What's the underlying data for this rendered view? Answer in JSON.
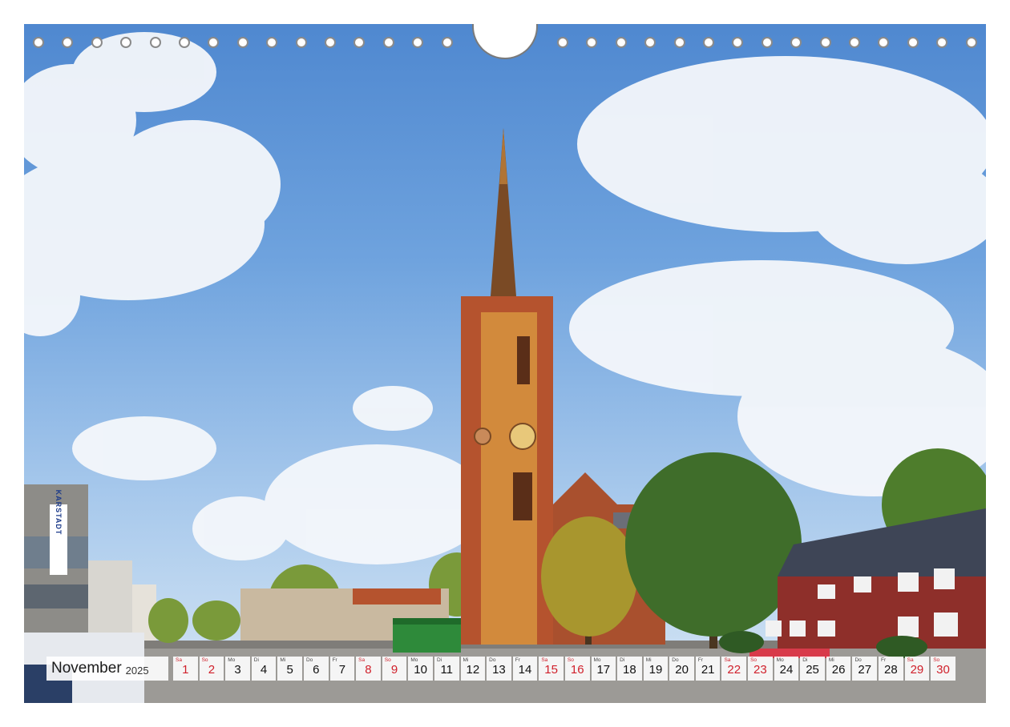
{
  "calendar": {
    "month": "November",
    "year": "2025",
    "days": [
      {
        "wd": "Sa",
        "num": "1",
        "weekend": true
      },
      {
        "wd": "So",
        "num": "2",
        "weekend": true
      },
      {
        "wd": "Mo",
        "num": "3",
        "weekend": false
      },
      {
        "wd": "Di",
        "num": "4",
        "weekend": false
      },
      {
        "wd": "Mi",
        "num": "5",
        "weekend": false
      },
      {
        "wd": "Do",
        "num": "6",
        "weekend": false
      },
      {
        "wd": "Fr",
        "num": "7",
        "weekend": false
      },
      {
        "wd": "Sa",
        "num": "8",
        "weekend": true
      },
      {
        "wd": "So",
        "num": "9",
        "weekend": true
      },
      {
        "wd": "Mo",
        "num": "10",
        "weekend": false
      },
      {
        "wd": "Di",
        "num": "11",
        "weekend": false
      },
      {
        "wd": "Mi",
        "num": "12",
        "weekend": false
      },
      {
        "wd": "Do",
        "num": "13",
        "weekend": false
      },
      {
        "wd": "Fr",
        "num": "14",
        "weekend": false
      },
      {
        "wd": "Sa",
        "num": "15",
        "weekend": true
      },
      {
        "wd": "So",
        "num": "16",
        "weekend": true
      },
      {
        "wd": "Mo",
        "num": "17",
        "weekend": false
      },
      {
        "wd": "Di",
        "num": "18",
        "weekend": false
      },
      {
        "wd": "Mi",
        "num": "19",
        "weekend": false
      },
      {
        "wd": "Do",
        "num": "20",
        "weekend": false
      },
      {
        "wd": "Fr",
        "num": "21",
        "weekend": false
      },
      {
        "wd": "Sa",
        "num": "22",
        "weekend": true
      },
      {
        "wd": "So",
        "num": "23",
        "weekend": true
      },
      {
        "wd": "Mo",
        "num": "24",
        "weekend": false
      },
      {
        "wd": "Di",
        "num": "25",
        "weekend": false
      },
      {
        "wd": "Mi",
        "num": "26",
        "weekend": false
      },
      {
        "wd": "Do",
        "num": "27",
        "weekend": false
      },
      {
        "wd": "Fr",
        "num": "28",
        "weekend": false
      },
      {
        "wd": "Sa",
        "num": "29",
        "weekend": true
      },
      {
        "wd": "So",
        "num": "30",
        "weekend": true
      }
    ]
  },
  "photo": {
    "store_sign": "KARSTADT"
  },
  "colors": {
    "weekend": "#d0202b",
    "sky": "#6fa3de",
    "brick": "#b5532e"
  }
}
